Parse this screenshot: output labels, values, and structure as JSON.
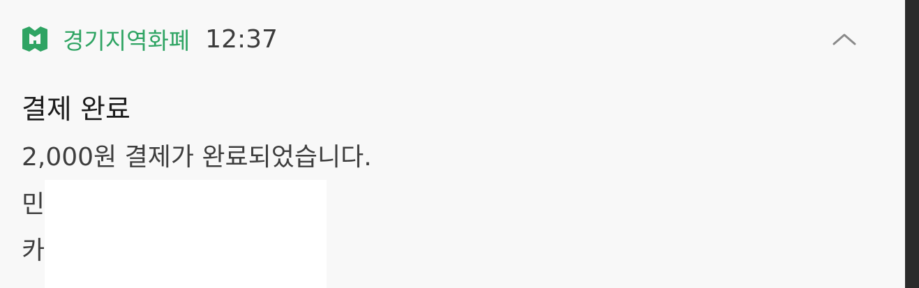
{
  "notification": {
    "app_name": "경기지역화폐",
    "time": "12:37",
    "title": "결제 완료",
    "lines": [
      "2,000원 결제가 완료되었습니다.",
      "민",
      "카"
    ],
    "app_icon": "gyeonggi-local-currency-logo",
    "collapse_icon": "chevron-up-icon",
    "accent_color": "#2fa463"
  }
}
